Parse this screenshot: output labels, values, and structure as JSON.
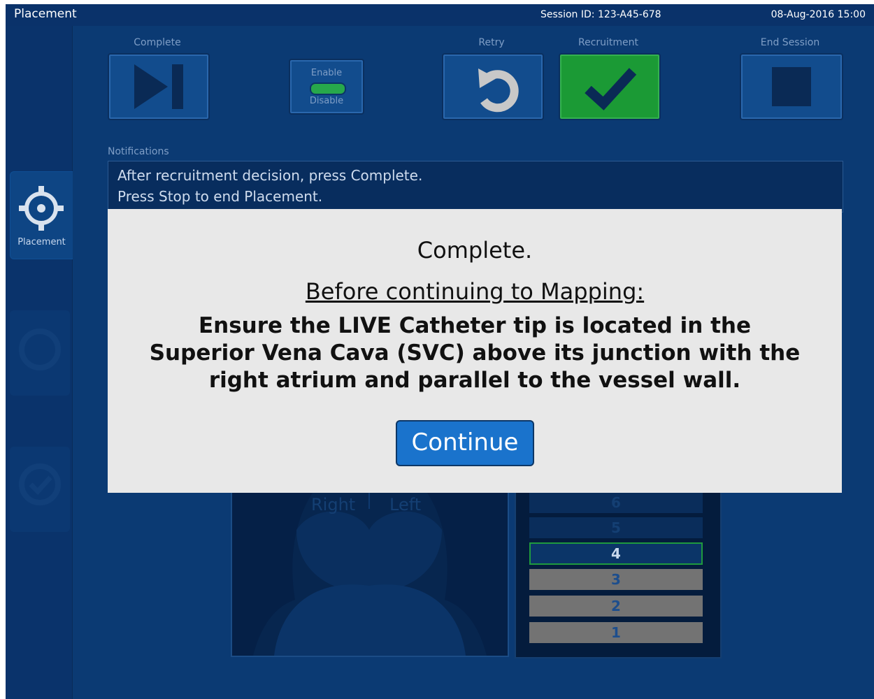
{
  "header": {
    "title": "Placement",
    "session": "Session ID: 123-A45-678",
    "datetime": "08-Aug-2016  15:00"
  },
  "nav": {
    "active_label": "Placement"
  },
  "toolbar": {
    "complete_label": "Complete",
    "enable_label": "Enable",
    "disable_label": "Disable",
    "retry_label": "Retry",
    "recruitment_label": "Recruitment",
    "end_session_label": "End Session"
  },
  "notifications": {
    "label": "Notifications",
    "lines": [
      "After recruitment decision, press Complete.",
      "Press Stop to end Placement."
    ]
  },
  "lung": {
    "right_label": "Right",
    "left_label": "Left"
  },
  "levels": [
    "6",
    "5",
    "4",
    "3",
    "2",
    "1"
  ],
  "selected_level": "4",
  "modal": {
    "title": "Complete.",
    "subtitle": "Before continuing to Mapping:",
    "body": "Ensure the LIVE Catheter tip is located in the Superior Vena Cava (SVC) above its junction with the right atrium and parallel to the vessel wall.",
    "button": "Continue"
  },
  "colors": {
    "background": "#0b3a73",
    "recruitment_active": "#1b9a35",
    "toggle_on": "#27a84b",
    "modal_bg": "#e8e8e8",
    "continue_button": "#1a73cc"
  }
}
